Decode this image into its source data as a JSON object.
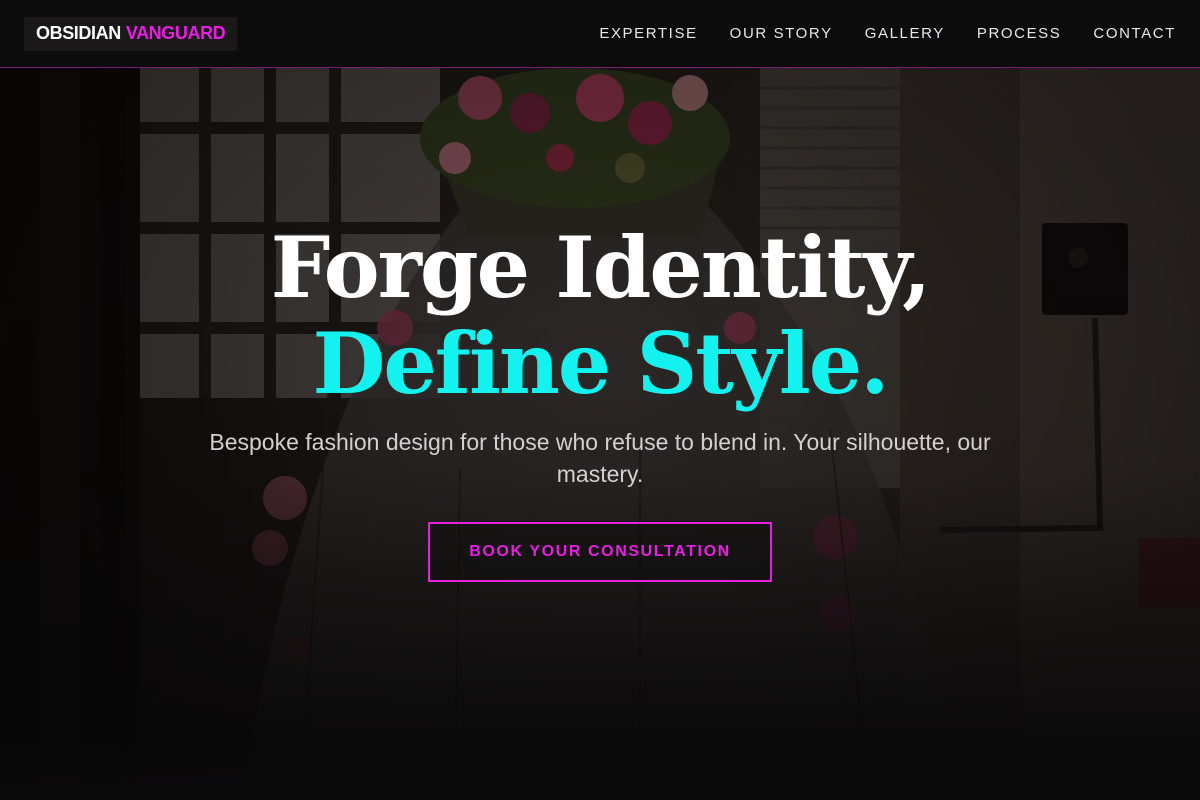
{
  "brand": {
    "logo_primary": "OBSIDIAN",
    "logo_accent": "VANGUARD"
  },
  "nav": {
    "items": [
      {
        "label": "EXPERTISE"
      },
      {
        "label": "OUR STORY"
      },
      {
        "label": "GALLERY"
      },
      {
        "label": "PROCESS"
      },
      {
        "label": "CONTACT"
      }
    ]
  },
  "hero": {
    "headline_line1": "Forge Identity,",
    "headline_line2": "Define Style.",
    "subtitle": "Bespoke fashion design for those who refuse to blend in. Your silhouette, our mastery.",
    "cta_label": "BOOK YOUR CONSULTATION"
  },
  "colors": {
    "accent_magenta": "#e81ee0",
    "accent_cyan": "#14f2f0",
    "navbar_bg": "#0d0c0d",
    "nav_text": "#e8e6e8"
  }
}
